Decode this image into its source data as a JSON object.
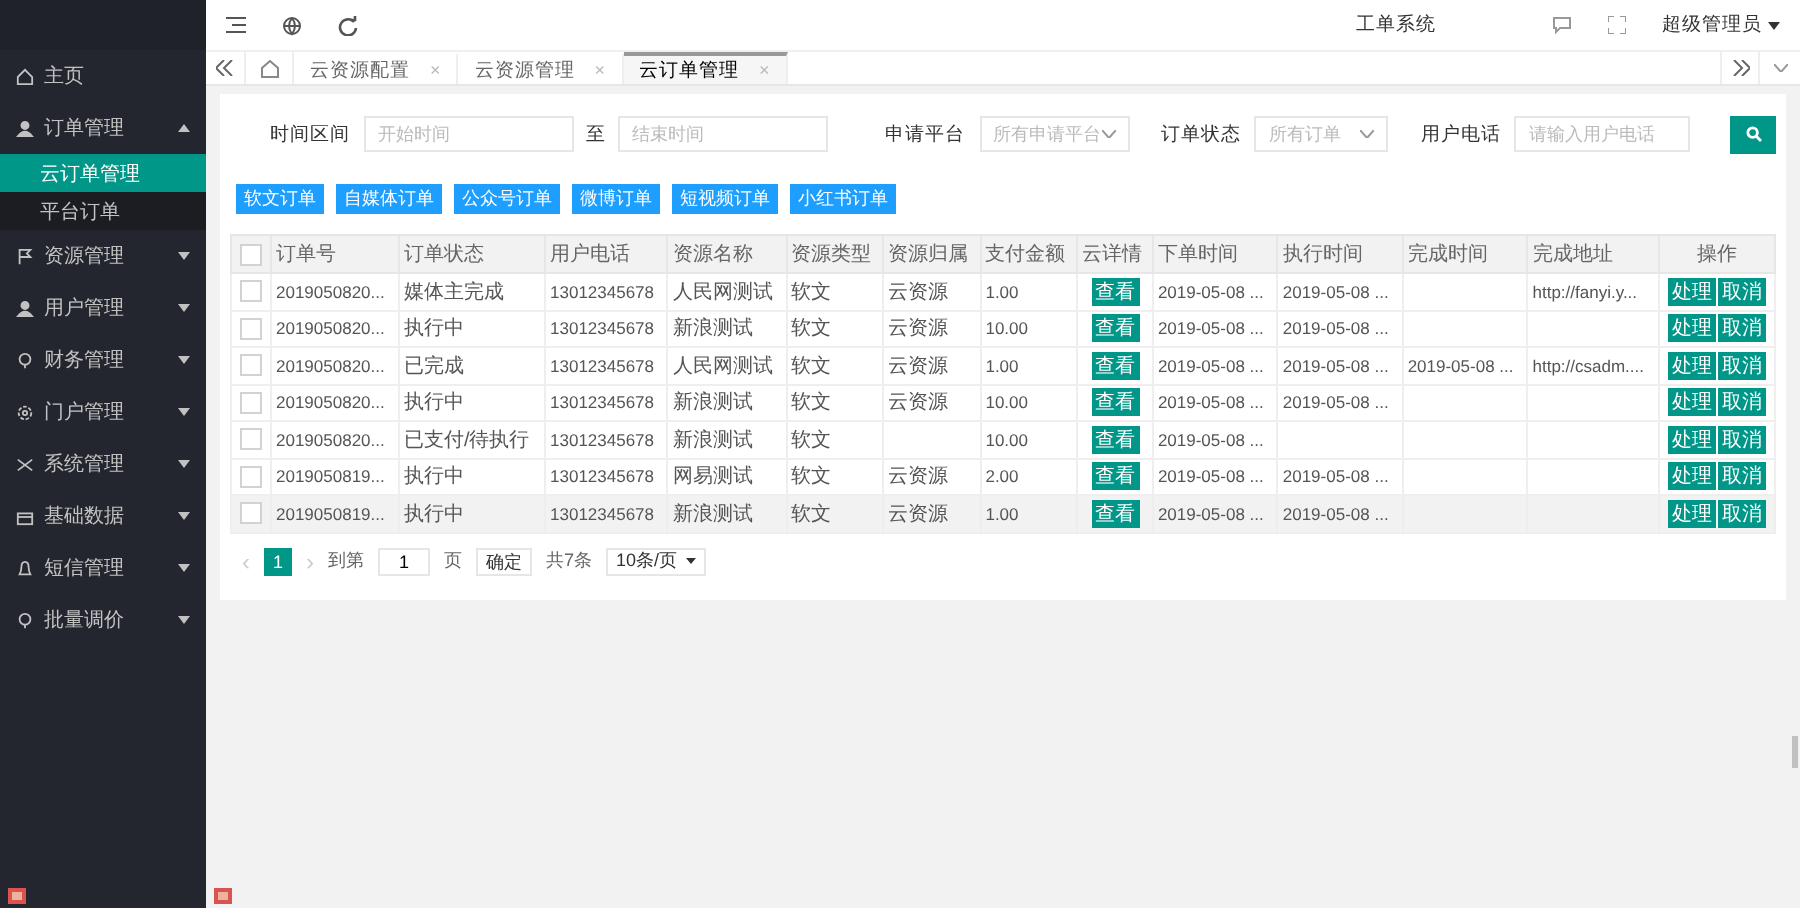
{
  "sidebar": {
    "items": [
      {
        "label": "主页"
      },
      {
        "label": "订单管理",
        "expanded": true,
        "children": [
          {
            "label": "云订单管理",
            "selected": true
          },
          {
            "label": "平台订单",
            "selected": false
          }
        ]
      },
      {
        "label": "资源管理",
        "expanded": false
      },
      {
        "label": "用户管理",
        "expanded": false
      },
      {
        "label": "财务管理",
        "expanded": false
      },
      {
        "label": "门户管理",
        "expanded": false
      },
      {
        "label": "系统管理",
        "expanded": false
      },
      {
        "label": "基础数据",
        "expanded": false
      },
      {
        "label": "短信管理",
        "expanded": false
      },
      {
        "label": "批量调价",
        "expanded": false
      }
    ]
  },
  "topbar": {
    "system_link": "工单系统",
    "user": "超级管理员"
  },
  "tabs": [
    {
      "label": "云资源配置",
      "close": "×",
      "selected": false
    },
    {
      "label": "云资源管理",
      "close": "×",
      "selected": false
    },
    {
      "label": "云订单管理",
      "close": "×",
      "selected": true
    }
  ],
  "filters": {
    "time_label": "时间区间",
    "start_placeholder": "开始时间",
    "to": "至",
    "end_placeholder": "结束时间",
    "platform_label": "申请平台",
    "platform_value": "所有申请平台",
    "status_label": "订单状态",
    "status_value": "所有订单",
    "phone_label": "用户电话",
    "phone_placeholder": "请输入用户电话"
  },
  "order_buttons": [
    "软文订单",
    "自媒体订单",
    "公众号订单",
    "微博订单",
    "短视频订单",
    "小红书订单"
  ],
  "table": {
    "all_checked": false,
    "columns": [
      "订单号",
      "订单状态",
      "用户电话",
      "资源名称",
      "资源类型",
      "资源归属",
      "支付金额",
      "云详情",
      "下单时间",
      "执行时间",
      "完成时间",
      "完成地址",
      "操作"
    ],
    "rows": [
      {
        "checked": false,
        "highlighted": false,
        "cells": [
          "2019050820...",
          "媒体主完成",
          "13012345678",
          "人民网测试",
          "软文",
          "云资源",
          "1.00",
          "查看",
          "2019-05-08 ...",
          "2019-05-08 ...",
          "",
          "http://fanyi.y...",
          ""
        ],
        "actions": [
          "处理",
          "取消"
        ]
      },
      {
        "checked": false,
        "highlighted": false,
        "cells": [
          "2019050820...",
          "执行中",
          "13012345678",
          "新浪测试",
          "软文",
          "云资源",
          "10.00",
          "查看",
          "2019-05-08 ...",
          "2019-05-08 ...",
          "",
          "",
          ""
        ],
        "actions": [
          "处理",
          "取消"
        ]
      },
      {
        "checked": false,
        "highlighted": false,
        "cells": [
          "2019050820...",
          "已完成",
          "13012345678",
          "人民网测试",
          "软文",
          "云资源",
          "1.00",
          "查看",
          "2019-05-08 ...",
          "2019-05-08 ...",
          "2019-05-08 ...",
          "http://csadm....",
          ""
        ],
        "actions": [
          "处理",
          "取消"
        ]
      },
      {
        "checked": false,
        "highlighted": false,
        "cells": [
          "2019050820...",
          "执行中",
          "13012345678",
          "新浪测试",
          "软文",
          "云资源",
          "10.00",
          "查看",
          "2019-05-08 ...",
          "2019-05-08 ...",
          "",
          "",
          ""
        ],
        "actions": [
          "处理",
          "取消"
        ]
      },
      {
        "checked": false,
        "highlighted": false,
        "cells": [
          "2019050820...",
          "已支付/待执行",
          "13012345678",
          "新浪测试",
          "软文",
          "",
          "10.00",
          "查看",
          "2019-05-08 ...",
          "",
          "",
          "",
          ""
        ],
        "actions": [
          "处理",
          "取消"
        ]
      },
      {
        "checked": false,
        "highlighted": false,
        "cells": [
          "2019050819...",
          "执行中",
          "13012345678",
          "网易测试",
          "软文",
          "云资源",
          "2.00",
          "查看",
          "2019-05-08 ...",
          "2019-05-08 ...",
          "",
          "",
          ""
        ],
        "actions": [
          "处理",
          "取消"
        ]
      },
      {
        "checked": false,
        "highlighted": true,
        "cells": [
          "2019050819...",
          "执行中",
          "13012345678",
          "新浪测试",
          "软文",
          "云资源",
          "1.00",
          "查看",
          "2019-05-08 ...",
          "2019-05-08 ...",
          "",
          "",
          ""
        ],
        "actions": [
          "处理",
          "取消"
        ]
      }
    ]
  },
  "pagination": {
    "prev": "‹",
    "pages": [
      {
        "label": "1",
        "selected": true
      }
    ],
    "next": "›",
    "goto_label": "到第",
    "page_value": "1",
    "page_unit": "页",
    "confirm": "确定",
    "total": "共7条",
    "page_size": "10条/页"
  }
}
